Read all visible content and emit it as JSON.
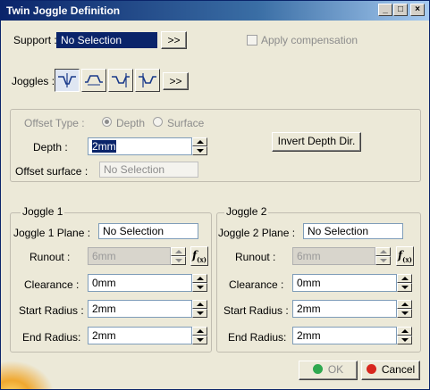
{
  "window": {
    "title": "Twin Joggle Definition"
  },
  "titlebar_buttons": {
    "minimize": "_",
    "maximize": "□",
    "close": "×"
  },
  "support": {
    "label": "Support :",
    "value": "No Selection",
    "more": ">>"
  },
  "apply_compensation": {
    "label": "Apply compensation",
    "checked": false
  },
  "joggles": {
    "label": "Joggles :",
    "more": ">>",
    "icons": [
      "joggle-type-1-icon",
      "joggle-type-2-icon",
      "joggle-type-3-icon",
      "joggle-type-4-icon"
    ]
  },
  "offset": {
    "type_label": "Offset Type :",
    "depth_option": "Depth",
    "surface_option": "Surface",
    "selected": "Depth",
    "depth_label": "Depth :",
    "depth_value": "2mm",
    "invert_button": "Invert Depth Dir.",
    "surface_label": "Offset surface :",
    "surface_value": "No Selection"
  },
  "joggle1": {
    "title": "Joggle 1",
    "plane_label": "Joggle 1 Plane :",
    "plane_value": "No Selection",
    "runout_label": "Runout :",
    "runout_value": "6mm",
    "clearance_label": "Clearance :",
    "clearance_value": "0mm",
    "start_radius_label": "Start Radius :",
    "start_radius_value": "2mm",
    "end_radius_label": "End Radius:",
    "end_radius_value": "2mm"
  },
  "joggle2": {
    "title": "Joggle 2",
    "plane_label": "Joggle 2 Plane :",
    "plane_value": "No Selection",
    "runout_label": "Runout :",
    "runout_value": "6mm",
    "clearance_label": "Clearance :",
    "clearance_value": "0mm",
    "start_radius_label": "Start Radius :",
    "start_radius_value": "2mm",
    "end_radius_label": "End Radius:",
    "end_radius_value": "2mm"
  },
  "footer": {
    "ok": "OK",
    "cancel": "Cancel"
  },
  "colors": {
    "title_bar": "#0a246a",
    "dialog_bg": "#ece9d8",
    "ok_dot": "#2fa84f",
    "cancel_dot": "#d7261e"
  }
}
